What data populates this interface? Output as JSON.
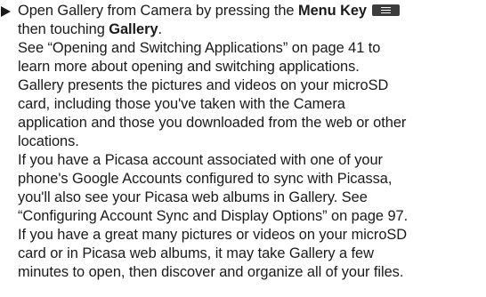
{
  "instructions": {
    "step_prefix": "Open Gallery from Camera by pressing the ",
    "menu_key_label": "Menu Key",
    "menu_key_icon": "menu-key-icon",
    "touch_prefix": "then touching ",
    "gallery_label": "Gallery",
    "touch_suffix": "."
  },
  "paragraphs": [
    "See “Opening and Switching Applications” on page 41 to",
    "learn more about opening and switching applications.",
    "Gallery presents the pictures and videos on your microSD",
    "card, including those you've taken with the Camera",
    "application and those you downloaded from the web or other",
    "locations.",
    "If you have a Picasa account associated with one of your",
    "phone's Google Accounts configured to sync with Picassa,",
    "you'll also see your Picasa web albums in Gallery. See",
    "“Configuring Account Sync and Display Options” on page 97.",
    "If you have a great many pictures or videos on your microSD",
    "card or in Picasa web albums, it may take Gallery a few",
    "minutes to open, then discover and organize all of your files."
  ]
}
